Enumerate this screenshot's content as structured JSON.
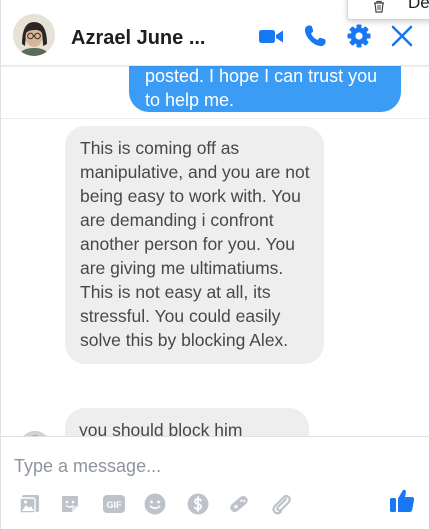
{
  "header": {
    "contact_name": "Azrael June ...",
    "popup_menu_label": "De"
  },
  "messages": {
    "sent_partial": "posted. I hope I can trust you to help me.",
    "received_1": "This is coming off as manipulative, and you are not being easy to work with. You are demanding i confront another person for you. You are giving me ultimatiums. This is not easy at all, its stressful. You could easily solve this by blocking Alex.",
    "received_2": "you should block him"
  },
  "composer": {
    "placeholder": "Type a message...",
    "value": "",
    "gif_label": "GIF"
  },
  "colors": {
    "accent": "#1877f2",
    "sent_bubble": "#3b9cf6",
    "received_bubble": "#eeeeee",
    "tool_icon": "#bec3c9"
  },
  "icons": {
    "header": [
      "video-camera-icon",
      "phone-icon",
      "gear-icon",
      "close-icon"
    ],
    "toolbar": [
      "photo-icon",
      "sticker-icon",
      "gif-icon",
      "emoji-icon",
      "dollar-icon",
      "games-icon",
      "attachment-icon",
      "thumbs-up-icon"
    ]
  }
}
